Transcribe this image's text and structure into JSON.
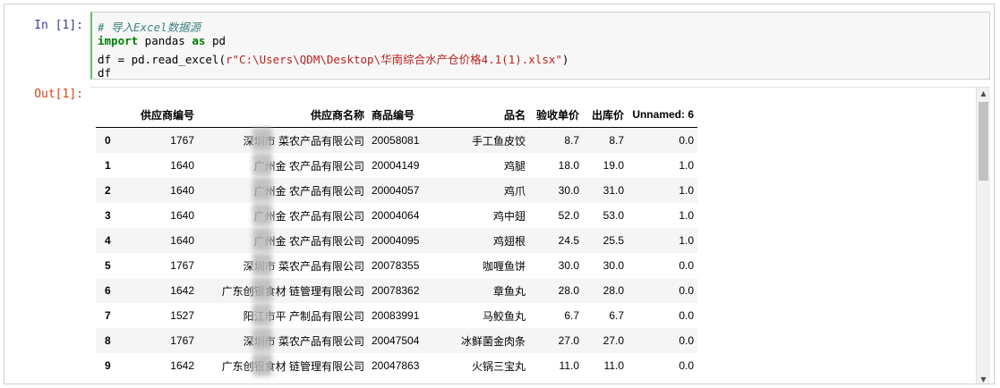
{
  "cell_in": {
    "prompt": "In  [1]:",
    "code": {
      "comment": "# 导入Excel数据源",
      "line2_kw1": "import",
      "line2_mod": " pandas ",
      "line2_kw2": "as",
      "line2_alias": " pd",
      "line3_pre": "df = pd.read_excel(",
      "line3_str": "r\"C:\\Users\\QDM\\Desktop\\华南综合水产仓价格4.1(1).xlsx\"",
      "line3_post": ")",
      "line4": "df"
    }
  },
  "cell_out": {
    "prompt": "Out[1]:",
    "table": {
      "columns": [
        "",
        "供应商编号",
        "供应商名称",
        "商品编号",
        "品名",
        "验收单价",
        "出库价",
        "Unnamed: 6"
      ],
      "rows": [
        [
          "0",
          "1767",
          "深圳市 菜农产品有限公司",
          "20058081",
          "手工鱼皮饺",
          "8.7",
          "8.7",
          "0.0"
        ],
        [
          "1",
          "1640",
          "广州金 农产品有限公司",
          "20004149",
          "鸡腿",
          "18.0",
          "19.0",
          "1.0"
        ],
        [
          "2",
          "1640",
          "广州金 农产品有限公司",
          "20004057",
          "鸡爪",
          "30.0",
          "31.0",
          "1.0"
        ],
        [
          "3",
          "1640",
          "广州金 农产品有限公司",
          "20004064",
          "鸡中翅",
          "52.0",
          "53.0",
          "1.0"
        ],
        [
          "4",
          "1640",
          "广州金 农产品有限公司",
          "20004095",
          "鸡翅根",
          "24.5",
          "25.5",
          "1.0"
        ],
        [
          "5",
          "1767",
          "深圳市 菜农产品有限公司",
          "20078355",
          "咖喱鱼饼",
          "30.0",
          "30.0",
          "0.0"
        ],
        [
          "6",
          "1642",
          "广东创银食材 链管理有限公司",
          "20078362",
          "章鱼丸",
          "28.0",
          "28.0",
          "0.0"
        ],
        [
          "7",
          "1527",
          "阳江市平 产制品有限公司",
          "20083991",
          "马鲛鱼丸",
          "6.7",
          "6.7",
          "0.0"
        ],
        [
          "8",
          "1767",
          "深圳市 菜农产品有限公司",
          "20047504",
          "冰鲜菌金肉条",
          "27.0",
          "27.0",
          "0.0"
        ],
        [
          "9",
          "1642",
          "广东创银食材 链管理有限公司",
          "20047863",
          "火锅三宝丸",
          "11.0",
          "11.0",
          "0.0"
        ]
      ]
    }
  },
  "colors": {
    "in_prompt": "#303f9f",
    "out_prompt": "#d84315",
    "cell_border_active": "#66bb6a"
  },
  "icons": {
    "scroll_up": "triangle-up",
    "scroll_down": "triangle-down"
  }
}
